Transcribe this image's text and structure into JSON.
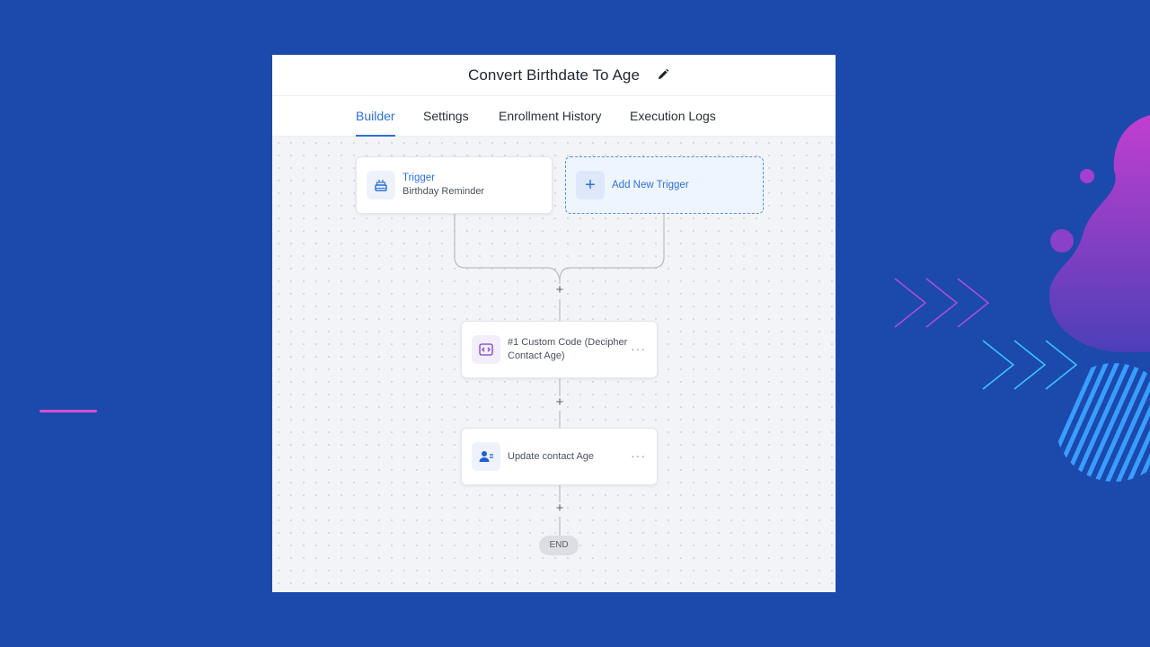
{
  "window": {
    "title": "Convert Birthdate To Age"
  },
  "tabs": [
    {
      "label": "Builder",
      "active": true
    },
    {
      "label": "Settings",
      "active": false
    },
    {
      "label": "Enrollment History",
      "active": false
    },
    {
      "label": "Execution Logs",
      "active": false
    }
  ],
  "trigger": {
    "heading": "Trigger",
    "name": "Birthday Reminder",
    "icon": "cake-icon"
  },
  "add_trigger": {
    "label": "Add New Trigger",
    "icon": "plus-icon"
  },
  "steps": [
    {
      "label": "#1 Custom Code (Decipher Contact Age)",
      "line1": "#1 Custom Code (Decipher",
      "line2": "Contact Age)",
      "icon": "code-icon"
    },
    {
      "label": "Update contact Age",
      "icon": "contact-card-icon"
    }
  ],
  "plus_glyph": "+",
  "more_glyph": "···",
  "end_label": "END",
  "colors": {
    "accent": "#2f6fdc",
    "background": "#1c49ac",
    "decor_magenta": "#d54fd0",
    "decor_cyan": "#3cc8ff"
  }
}
